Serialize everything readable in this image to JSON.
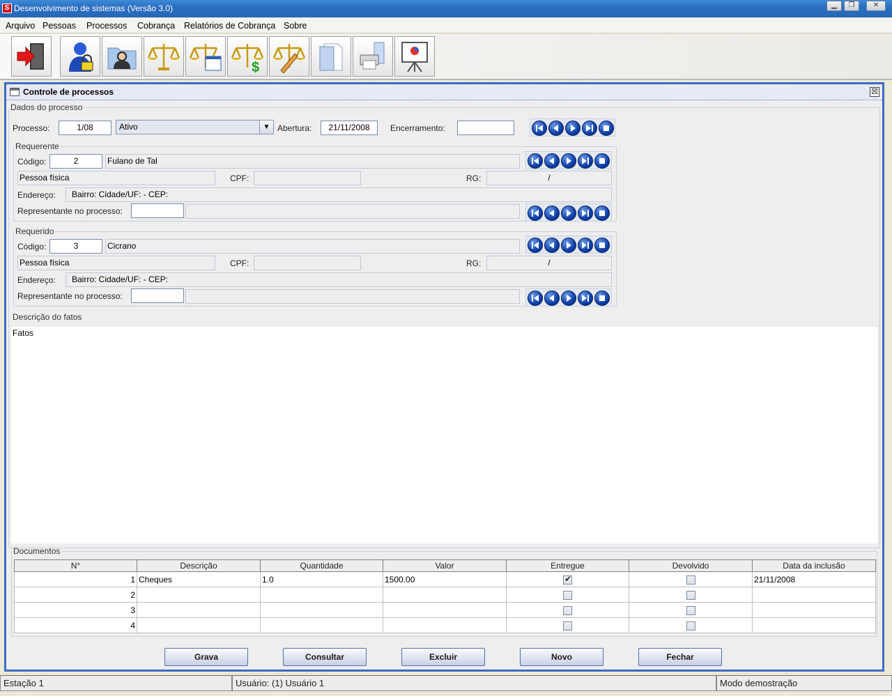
{
  "window": {
    "title": "Desenvolvimento de sistemas (Versão 3.0)",
    "app_icon": "S",
    "buttons": [
      "minimize",
      "restore",
      "close"
    ]
  },
  "menu": [
    "Arquivo",
    "Pessoas",
    "Processos",
    "Cobrança",
    "Relatórios de Cobrança",
    "Sobre"
  ],
  "toolbar": [
    "exit-icon",
    "user-security-icon",
    "person-folder-icon",
    "scales-icon",
    "scales-window-icon",
    "scales-money-icon",
    "scales-edit-icon",
    "documents-icon",
    "printer-icon",
    "presentation-chart-icon"
  ],
  "internal_frame": {
    "title": "Controle de processos",
    "close": "☒"
  },
  "dados": {
    "legend": "Dados do processo",
    "processo_label": "Processo:",
    "processo_value": "1/08",
    "status_value": "Ativo",
    "abertura_label": "Abertura:",
    "abertura_value": "21/11/2008",
    "encerramento_label": "Encerramento:",
    "encerramento_value": ""
  },
  "requerente": {
    "legend": "Requerente",
    "codigo_label": "Código:",
    "codigo_value": "2",
    "nome": "Fulano de Tal",
    "tipo": "Pessoa física",
    "cpf_label": "CPF:",
    "cpf_value": "",
    "rg_label": "RG:",
    "rg_value": "/",
    "endereco_label": "Endereço:",
    "endereco_value": "Bairro:  Cidade/UF:  - CEP:",
    "rep_label": "Representante no processo:",
    "rep_code": "",
    "rep_name": ""
  },
  "requerido": {
    "legend": "Requerido",
    "codigo_label": "Código:",
    "codigo_value": "3",
    "nome": "Cicrano",
    "tipo": "Pessoa física",
    "cpf_label": "CPF:",
    "cpf_value": "",
    "rg_label": "RG:",
    "rg_value": "/",
    "endereco_label": "Endereço:",
    "endereco_value": "Bairro:  Cidade/UF:  - CEP:",
    "rep_label": "Representante no processo:",
    "rep_code": "",
    "rep_name": ""
  },
  "fatos": {
    "legend": "Descrição do fatos",
    "text": "Fatos"
  },
  "documentos": {
    "legend": "Documentos",
    "columns": [
      "N°",
      "Descrição",
      "Quantidade",
      "Valor",
      "Entregue",
      "Devolvido",
      "Data da inclusão"
    ],
    "rows": [
      {
        "n": "1",
        "descricao": "Cheques",
        "quantidade": "1.0",
        "valor": "1500.00",
        "entregue": true,
        "devolvido": false,
        "data": "21/11/2008"
      },
      {
        "n": "2",
        "descricao": "",
        "quantidade": "",
        "valor": "",
        "entregue": false,
        "devolvido": false,
        "data": ""
      },
      {
        "n": "3",
        "descricao": "",
        "quantidade": "",
        "valor": "",
        "entregue": false,
        "devolvido": false,
        "data": ""
      },
      {
        "n": "4",
        "descricao": "",
        "quantidade": "",
        "valor": "",
        "entregue": false,
        "devolvido": false,
        "data": ""
      }
    ]
  },
  "actions": {
    "grava": "Grava",
    "consultar": "Consultar",
    "excluir": "Excluir",
    "novo": "Novo",
    "fechar": "Fechar"
  },
  "status": {
    "estacao": "Estação 1",
    "usuario": "Usuário: (1) Usuário 1",
    "modo": "Modo demostração"
  },
  "colors": {
    "accent": "#3C6BC6",
    "titlebar": "#2A6FC0",
    "nav_button": "#0F3FA8"
  }
}
